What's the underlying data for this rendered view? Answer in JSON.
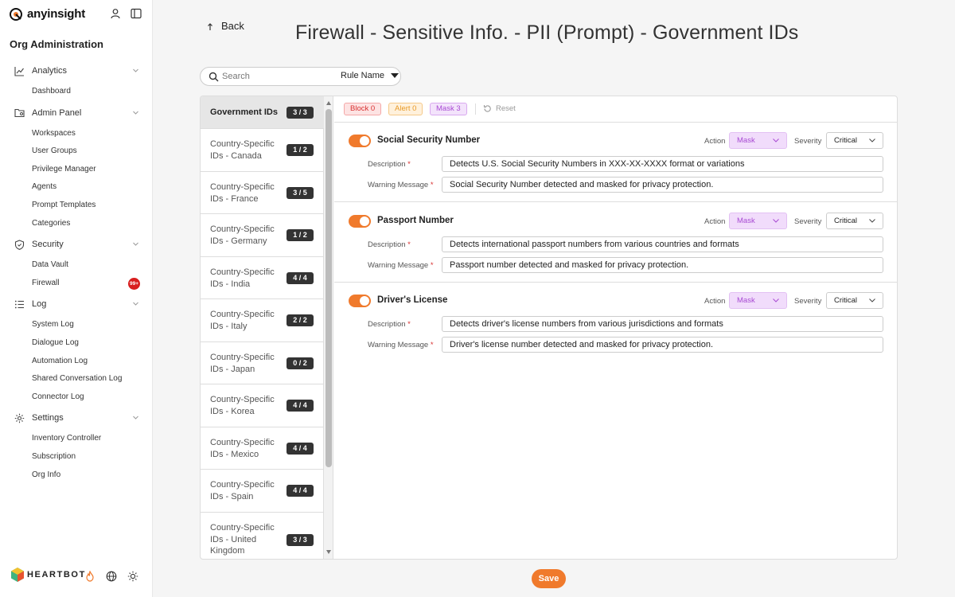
{
  "app": {
    "brand": "anyinsight",
    "org_title": "Org Administration"
  },
  "sidebar": {
    "groups": [
      {
        "label": "Analytics",
        "icon": "chart-line-icon",
        "items": [
          "Dashboard"
        ]
      },
      {
        "label": "Admin Panel",
        "icon": "folder-user-icon",
        "items": [
          "Workspaces",
          "User Groups",
          "Privilege Manager",
          "Agents",
          "Prompt Templates",
          "Categories"
        ]
      },
      {
        "label": "Security",
        "icon": "shield-icon",
        "items": [
          "Data Vault",
          "Firewall"
        ]
      },
      {
        "label": "Log",
        "icon": "list-icon",
        "items": [
          "System Log",
          "Dialogue Log",
          "Automation Log",
          "Shared Conversation Log",
          "Connector Log"
        ]
      },
      {
        "label": "Settings",
        "icon": "gear-icon",
        "items": [
          "Inventory Controller",
          "Subscription",
          "Org Info"
        ]
      }
    ],
    "firewall_badge": "99+",
    "footer_brand": "HEARTBOT"
  },
  "header": {
    "back_label": "Back",
    "title": "Firewall - Sensitive Info. - PII (Prompt) - Government IDs"
  },
  "search": {
    "placeholder": "Search",
    "filter_label": "Rule Name"
  },
  "categories": [
    {
      "name": "Government IDs",
      "count": "3 / 3",
      "active": true
    },
    {
      "name": "Country-Specific IDs - Canada",
      "count": "1 / 2"
    },
    {
      "name": "Country-Specific IDs - France",
      "count": "3 / 5"
    },
    {
      "name": "Country-Specific IDs - Germany",
      "count": "1 / 2"
    },
    {
      "name": "Country-Specific IDs - India",
      "count": "4 / 4"
    },
    {
      "name": "Country-Specific IDs - Italy",
      "count": "2 / 2"
    },
    {
      "name": "Country-Specific IDs - Japan",
      "count": "0 / 2"
    },
    {
      "name": "Country-Specific IDs - Korea",
      "count": "4 / 4"
    },
    {
      "name": "Country-Specific IDs - Mexico",
      "count": "4 / 4"
    },
    {
      "name": "Country-Specific IDs - Spain",
      "count": "4 / 4"
    },
    {
      "name": "Country-Specific IDs - United Kingdom",
      "count": "3 / 3"
    }
  ],
  "toolbar": {
    "block": "Block 0",
    "alert": "Alert 0",
    "mask": "Mask 3",
    "reset": "Reset"
  },
  "labels": {
    "action": "Action",
    "severity": "Severity",
    "description": "Description",
    "warning": "Warning Message"
  },
  "rules": [
    {
      "name": "Social Security Number",
      "enabled": true,
      "action": "Mask",
      "severity": "Critical",
      "description": "Detects U.S. Social Security Numbers in XXX-XX-XXXX format or variations",
      "warning": "Social Security Number detected and masked for privacy protection."
    },
    {
      "name": "Passport Number",
      "enabled": true,
      "action": "Mask",
      "severity": "Critical",
      "description": "Detects international passport numbers from various countries and formats",
      "warning": "Passport number detected and masked for privacy protection."
    },
    {
      "name": "Driver's License",
      "enabled": true,
      "action": "Mask",
      "severity": "Critical",
      "description": "Detects driver's license numbers from various jurisdictions and formats",
      "warning": "Driver's license number detected and masked for privacy protection."
    }
  ],
  "save_label": "Save",
  "colors": {
    "accent": "#f07a2c",
    "block": "#d83131",
    "alert": "#e89b2a",
    "mask": "#a84bd3"
  }
}
